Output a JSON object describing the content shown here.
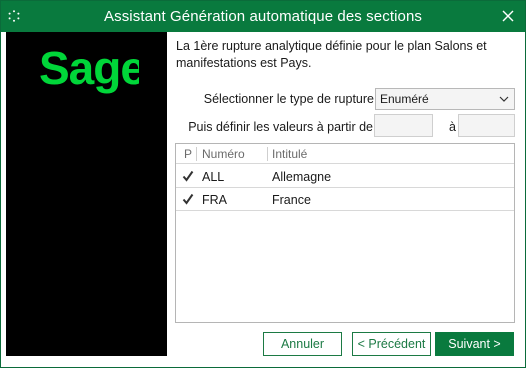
{
  "window": {
    "title": "Assistant Génération automatique des sections",
    "app_icon": "sage-app-icon",
    "close_icon": "close-icon",
    "accent_color": "#097a3e"
  },
  "sidebar": {
    "logo_text": "Sage",
    "logo_color": "#00d639",
    "background": "#000000"
  },
  "message": {
    "line1": "La 1ère rupture analytique définie pour le plan Salons et",
    "line2": "manifestations est Pays."
  },
  "rupture_type": {
    "label": "Sélectionner le type de rupture",
    "selected": "Enuméré"
  },
  "value_range": {
    "label": "Puis définir les valeurs à partir de",
    "to_label": "à",
    "from_value": "",
    "to_value": ""
  },
  "list": {
    "columns": [
      "P",
      "Numéro",
      "Intitulé"
    ],
    "rows": [
      {
        "checked": true,
        "numero": "ALL",
        "intitule": "Allemagne"
      },
      {
        "checked": true,
        "numero": "FRA",
        "intitule": "France"
      }
    ]
  },
  "buttons": {
    "cancel": "Annuler",
    "previous": "< Précédent",
    "next": "Suivant >"
  }
}
